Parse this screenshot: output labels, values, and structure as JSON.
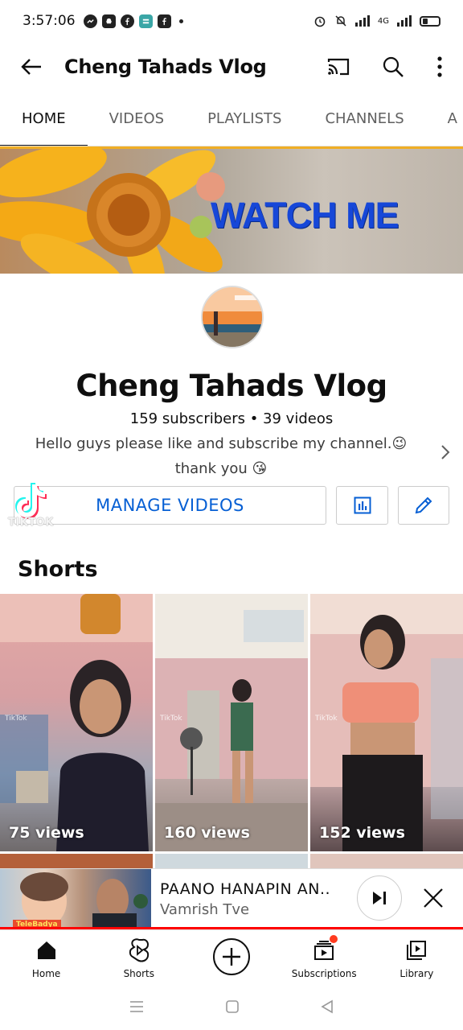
{
  "status_bar": {
    "time": "3:57:06",
    "network": "4G",
    "apps": [
      "messenger-icon",
      "snapchat-icon",
      "facebook-icon",
      "teal-app-icon",
      "facebook-square-icon"
    ]
  },
  "app_bar": {
    "title": "Cheng Tahads Vlog"
  },
  "tabs": [
    {
      "label": "HOME",
      "active": true
    },
    {
      "label": "VIDEOS",
      "active": false
    },
    {
      "label": "PLAYLISTS",
      "active": false
    },
    {
      "label": "CHANNELS",
      "active": false
    },
    {
      "label": "A",
      "active": false
    }
  ],
  "banner": {
    "text": "WATCH ME"
  },
  "channel": {
    "name": "Cheng Tahads Vlog",
    "stats": "159 subscribers • 39 videos",
    "description_line1": "Hello guys please like and subscribe my channel.😉",
    "description_line2": "thank you 😘"
  },
  "actions": {
    "manage_label": "MANAGE VIDEOS",
    "watermark": "TIKTOK"
  },
  "shorts": {
    "title": "Shorts",
    "items": [
      {
        "views": "75 views"
      },
      {
        "views": "160 views"
      },
      {
        "views": "152 views"
      }
    ]
  },
  "mini_player": {
    "title": "PAANO HANAPIN AN..",
    "channel": "Vamrish Tve",
    "thumb_label": "TeleBadya"
  },
  "bottom_nav": [
    {
      "label": "Home",
      "icon": "home-icon"
    },
    {
      "label": "Shorts",
      "icon": "shorts-icon"
    },
    {
      "label": "",
      "icon": "create-icon"
    },
    {
      "label": "Subscriptions",
      "icon": "subscriptions-icon"
    },
    {
      "label": "Library",
      "icon": "library-icon"
    }
  ],
  "colors": {
    "accent_blue": "#065fd4",
    "banner_text": "#1647d8",
    "progress_red": "#ff0000"
  }
}
